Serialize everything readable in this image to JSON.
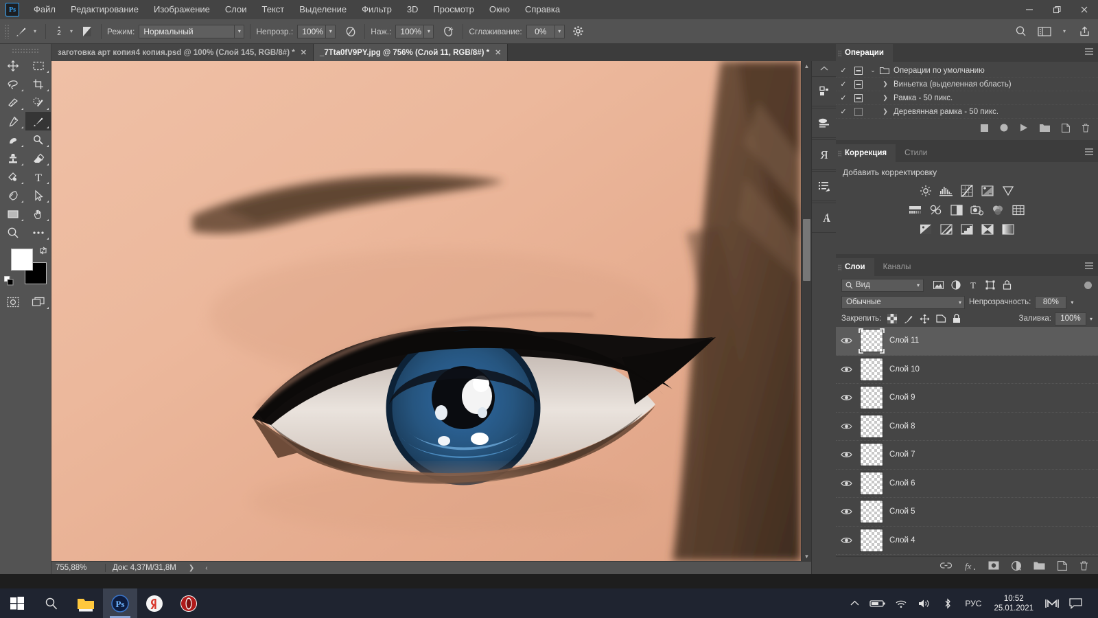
{
  "window": {
    "app_icon": "photoshop-logo",
    "minimize": "–",
    "maximize": "❐",
    "close": "✕"
  },
  "menu": {
    "items": [
      "Файл",
      "Редактирование",
      "Изображение",
      "Слои",
      "Текст",
      "Выделение",
      "Фильтр",
      "3D",
      "Просмотр",
      "Окно",
      "Справка"
    ]
  },
  "options_bar": {
    "brush_size": "2",
    "mode_label": "Режим:",
    "mode_value": "Нормальный",
    "opacity_label": "Непрозр.:",
    "opacity_value": "100%",
    "flow_label": "Наж.:",
    "flow_value": "100%",
    "smoothing_label": "Сглаживание:",
    "smoothing_value": "0%"
  },
  "tabs": [
    {
      "title": "заготовка арт копия4 копия.psd @ 100% (Слой 145, RGB/8#) *",
      "close": "✕",
      "active": false
    },
    {
      "title": "_7Tta0fV9PY.jpg @ 756% (Слой 11, RGB/8#) *",
      "close": "✕",
      "active": true
    }
  ],
  "status_bar": {
    "zoom": "755,88%",
    "doc_info": "Док: 4,37M/31,8M",
    "expand": "❯",
    "prev": "‹"
  },
  "actions_panel": {
    "tab": "Операции",
    "rows": [
      {
        "checked": "✓",
        "has_box": true,
        "expanded": true,
        "arrow": "⌄",
        "folder": true,
        "name": "Операции по умолчанию"
      },
      {
        "checked": "✓",
        "has_box": true,
        "expanded": false,
        "arrow": "❯",
        "folder": false,
        "name": "Виньетка (выделенная область)"
      },
      {
        "checked": "✓",
        "has_box": true,
        "expanded": false,
        "arrow": "❯",
        "folder": false,
        "name": "Рамка - 50 пикс."
      },
      {
        "checked": "✓",
        "has_box": false,
        "expanded": false,
        "arrow": "❯",
        "folder": false,
        "name": "Деревянная рамка - 50 пикс."
      }
    ],
    "footer_icons": [
      "stop-icon",
      "record-icon",
      "play-icon",
      "new-set-icon",
      "new-action-icon",
      "delete-icon"
    ]
  },
  "adjustments_panel": {
    "tabs": [
      {
        "label": "Коррекция",
        "active": true
      },
      {
        "label": "Стили",
        "active": false
      }
    ],
    "title": "Добавить корректировку",
    "row1": [
      "brightness-contrast-icon",
      "levels-icon",
      "curves-icon",
      "exposure-icon",
      "vibrance-icon"
    ],
    "row2": [
      "hue-saturation-icon",
      "color-balance-icon",
      "black-white-icon",
      "photo-filter-icon",
      "channel-mixer-icon",
      "color-lookup-icon"
    ],
    "row3": [
      "invert-icon",
      "posterize-icon",
      "threshold-icon",
      "selective-color-icon",
      "gradient-map-icon"
    ]
  },
  "layers_panel": {
    "tabs": [
      {
        "label": "Слои",
        "active": true
      },
      {
        "label": "Каналы",
        "active": false
      }
    ],
    "filter_label": "Вид",
    "filter_icons": [
      "pixel-filter-icon",
      "adjustment-filter-icon",
      "type-filter-icon",
      "shape-filter-icon",
      "smart-object-filter-icon"
    ],
    "blend_mode": "Обычные",
    "opacity_label": "Непрозрачность:",
    "opacity_value": "80%",
    "lock_label": "Закрепить:",
    "lock_icons": [
      "lock-transparent-icon",
      "lock-image-icon",
      "lock-position-icon",
      "lock-artboard-icon",
      "lock-all-icon"
    ],
    "fill_label": "Заливка:",
    "fill_value": "100%",
    "layers": [
      {
        "name": "Слой 11",
        "visible": true,
        "selected": true
      },
      {
        "name": "Слой 10",
        "visible": true,
        "selected": false
      },
      {
        "name": "Слой 9",
        "visible": true,
        "selected": false
      },
      {
        "name": "Слой 8",
        "visible": true,
        "selected": false
      },
      {
        "name": "Слой 7",
        "visible": true,
        "selected": false
      },
      {
        "name": "Слой 6",
        "visible": true,
        "selected": false
      },
      {
        "name": "Слой 5",
        "visible": true,
        "selected": false
      },
      {
        "name": "Слой 4",
        "visible": true,
        "selected": false
      }
    ],
    "footer_icons": [
      "link-layers-icon",
      "fx-icon",
      "add-mask-icon",
      "new-fill-adjustment-icon",
      "new-group-icon",
      "new-layer-icon",
      "delete-layer-icon"
    ]
  },
  "toolbar": {
    "tools": [
      "move-tool",
      "rectangular-marquee-tool",
      "lasso-tool",
      "crop-tool",
      "frame-tool",
      "spot-healing-brush-tool",
      "eyedropper-tool",
      "brush-tool",
      "clone-source-tool",
      "dodge-tool",
      "clone-stamp-tool",
      "eraser-tool",
      "gradient-tool",
      "type-tool",
      "pen-tool",
      "path-selection-tool",
      "rectangle-tool",
      "hand-tool",
      "zoom-tool",
      "edit-toolbar-tool"
    ],
    "selected_tool": "brush-tool",
    "foreground_color": "#ffffff",
    "background_color": "#000000",
    "quick_mask": "quick-mask-icon",
    "screen_mode": "screen-mode-icon"
  },
  "rail_icons": [
    "libraries-icon",
    "brush-settings-icon",
    "history-icon",
    "paragraph-styles-icon",
    "character-icon"
  ],
  "taskbar": {
    "items": [
      "windows-start-icon",
      "search-icon",
      "file-explorer-icon",
      "photoshop-icon",
      "yandex-browser-icon",
      "opera-icon"
    ],
    "tray_icons": [
      "show-hidden-icons-icon",
      "battery-icon",
      "wifi-icon",
      "volume-icon",
      "bluetooth-icon"
    ],
    "language": "РУС",
    "time": "10:52",
    "date": "25.01.2021",
    "extra_icons": [
      "mega-icon",
      "action-center-icon"
    ]
  },
  "colors": {
    "accent": "#31a8ff",
    "panel_bg": "#454545",
    "chrome_bg": "#535353",
    "canvas_bg": "#3c3c3c",
    "taskbar_bg": "#1f2430",
    "skin": "#e8b296",
    "iris": "#2a5f96"
  }
}
